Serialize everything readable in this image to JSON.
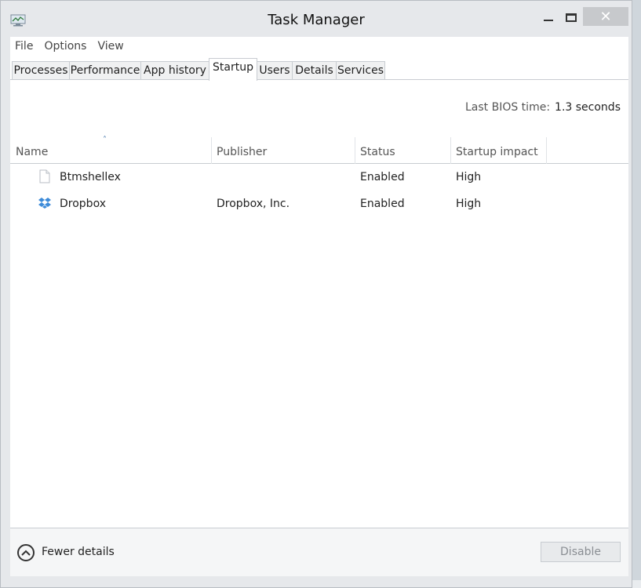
{
  "window": {
    "title": "Task Manager",
    "close_glyph": "✕"
  },
  "menu": [
    "File",
    "Options",
    "View"
  ],
  "tabs": [
    {
      "label": "Processes",
      "active": false
    },
    {
      "label": "Performance",
      "active": false
    },
    {
      "label": "App history",
      "active": false
    },
    {
      "label": "Startup",
      "active": true
    },
    {
      "label": "Users",
      "active": false
    },
    {
      "label": "Details",
      "active": false
    },
    {
      "label": "Services",
      "active": false
    }
  ],
  "startup": {
    "bios_label": "Last BIOS time:",
    "bios_value": "1.3 seconds",
    "columns": {
      "name": "Name",
      "publisher": "Publisher",
      "status": "Status",
      "impact": "Startup impact"
    },
    "sort_indicator": "˄",
    "rows": [
      {
        "icon": "blank-file-icon",
        "name": "Btmshellex",
        "publisher": "",
        "status": "Enabled",
        "impact": "High"
      },
      {
        "icon": "dropbox-icon",
        "name": "Dropbox",
        "publisher": "Dropbox, Inc.",
        "status": "Enabled",
        "impact": "High"
      }
    ]
  },
  "footer": {
    "fewer_details": "Fewer details",
    "disable_label": "Disable"
  },
  "colors": {
    "dropbox_blue": "#3d8bd9",
    "accent": "#3a6ea5"
  }
}
